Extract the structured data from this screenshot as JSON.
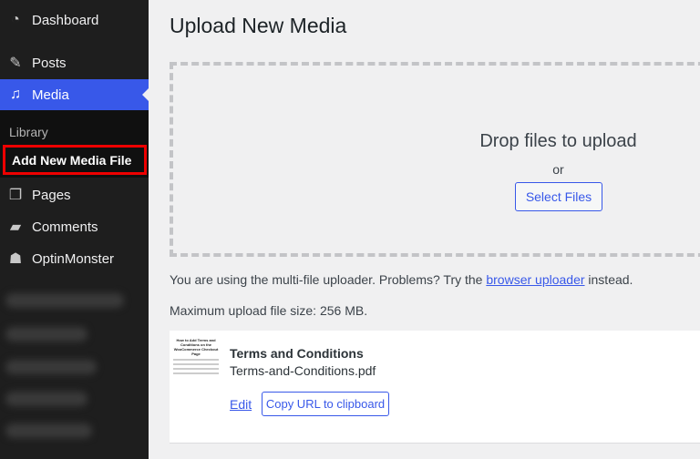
{
  "sidebar": {
    "items": [
      {
        "label": "Dashboard",
        "icon": "dashboard-icon"
      },
      {
        "label": "Posts",
        "icon": "pin-icon"
      },
      {
        "label": "Media",
        "icon": "media-icon",
        "active": true
      },
      {
        "label": "Pages",
        "icon": "pages-icon"
      },
      {
        "label": "Comments",
        "icon": "comment-icon"
      },
      {
        "label": "OptinMonster",
        "icon": "optinmonster-icon"
      }
    ],
    "submenu": {
      "library": "Library",
      "add_new": "Add New Media File"
    }
  },
  "main": {
    "title": "Upload New Media",
    "drop_title": "Drop files to upload",
    "or": "or",
    "select_files": "Select Files",
    "note_prefix": "You are using the multi-file uploader. Problems? Try the ",
    "note_link": "browser uploader",
    "note_suffix": " instead.",
    "max_size": "Maximum upload file size: 256 MB.",
    "file": {
      "thumb_title": "How to Add Terms and Conditions on the WooCommerce Checkout Page",
      "title": "Terms and Conditions",
      "filename": "Terms-and-Conditions.pdf",
      "edit": "Edit",
      "copy_url": "Copy URL to clipboard"
    }
  },
  "colors": {
    "accent": "#3858e9",
    "sidebar": "#1e1e1e",
    "highlight_border": "#e00000"
  }
}
